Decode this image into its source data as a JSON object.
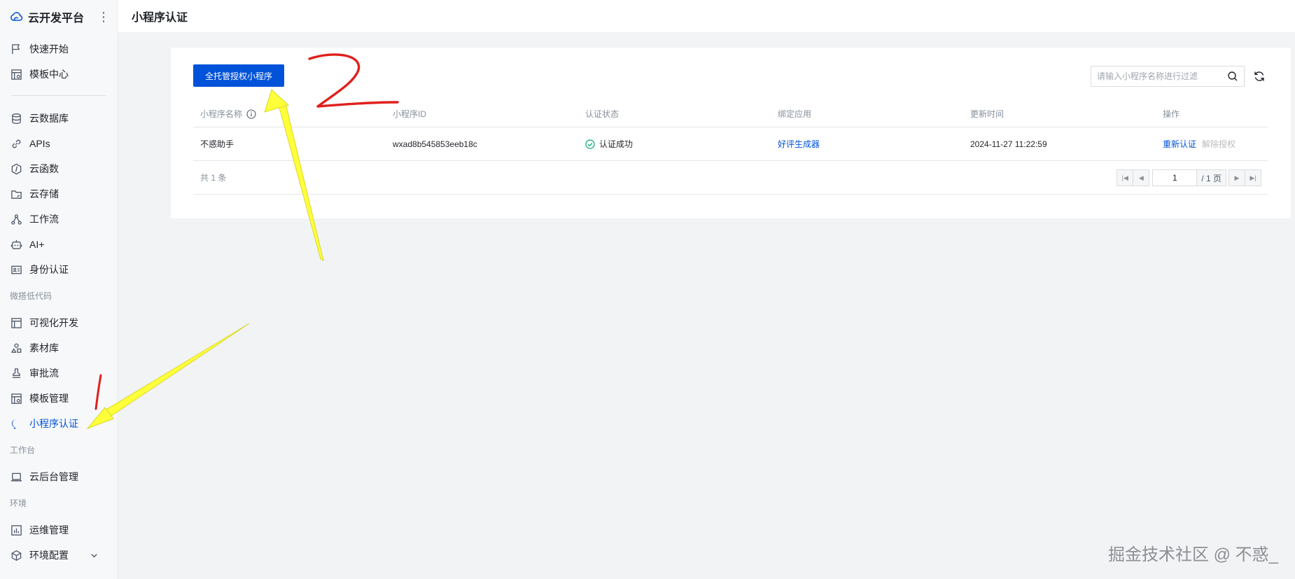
{
  "sidebar": {
    "brand_title": "云开发平台",
    "more_label": "⋮",
    "group1": [
      {
        "label": "快速开始",
        "icon": "flag-icon"
      },
      {
        "label": "模板中心",
        "icon": "template-center-icon"
      }
    ],
    "group2": [
      {
        "label": "云数据库",
        "icon": "database-icon"
      },
      {
        "label": "APIs",
        "icon": "link-icon"
      },
      {
        "label": "云函数",
        "icon": "function-icon"
      },
      {
        "label": "云存储",
        "icon": "storage-icon"
      },
      {
        "label": "工作流",
        "icon": "workflow-icon"
      },
      {
        "label": "AI+",
        "icon": "robot-icon"
      },
      {
        "label": "身份认证",
        "icon": "id-card-icon"
      }
    ],
    "section_lowcode": "微搭低代码",
    "group3": [
      {
        "label": "可视化开发",
        "icon": "layout-icon"
      },
      {
        "label": "素材库",
        "icon": "shapes-icon"
      },
      {
        "label": "审批流",
        "icon": "stamp-icon"
      },
      {
        "label": "模板管理",
        "icon": "template-manage-icon"
      },
      {
        "label": "小程序认证",
        "icon": "chat-bubble-icon",
        "active": true
      }
    ],
    "section_workbench": "工作台",
    "group4": [
      {
        "label": "云后台管理",
        "icon": "laptop-icon"
      }
    ],
    "section_env": "环境",
    "group5": [
      {
        "label": "运维管理",
        "icon": "bar-chart-icon"
      },
      {
        "label": "环境配置",
        "icon": "cube-icon"
      }
    ]
  },
  "header": {
    "title": "小程序认证"
  },
  "toolbar": {
    "primary_button": "全托管授权小程序",
    "search_placeholder": "请输入小程序名称进行过滤"
  },
  "table": {
    "columns": [
      "小程序名称",
      "小程序ID",
      "认证状态",
      "绑定应用",
      "更新时间",
      "操作"
    ],
    "rows": [
      {
        "name": "不惑助手",
        "id": "wxad8b545853eeb18c",
        "status": "认证成功",
        "app": "好评生成器",
        "updated": "2024-11-27 11:22:59",
        "action_primary": "重新认证",
        "action_disabled": "解除授权"
      }
    ]
  },
  "pagination": {
    "total": "共 1 条",
    "current_page": "1",
    "total_pages": "/ 1 页"
  },
  "annotations": {
    "mark_1": "1",
    "mark_2": "2",
    "arrow_color": "#ffff3a",
    "ink_color": "#e0201c"
  },
  "watermark": "掘金技术社区 @ 不惑_",
  "colors": {
    "primary": "#0052d9",
    "success": "#00a870"
  }
}
